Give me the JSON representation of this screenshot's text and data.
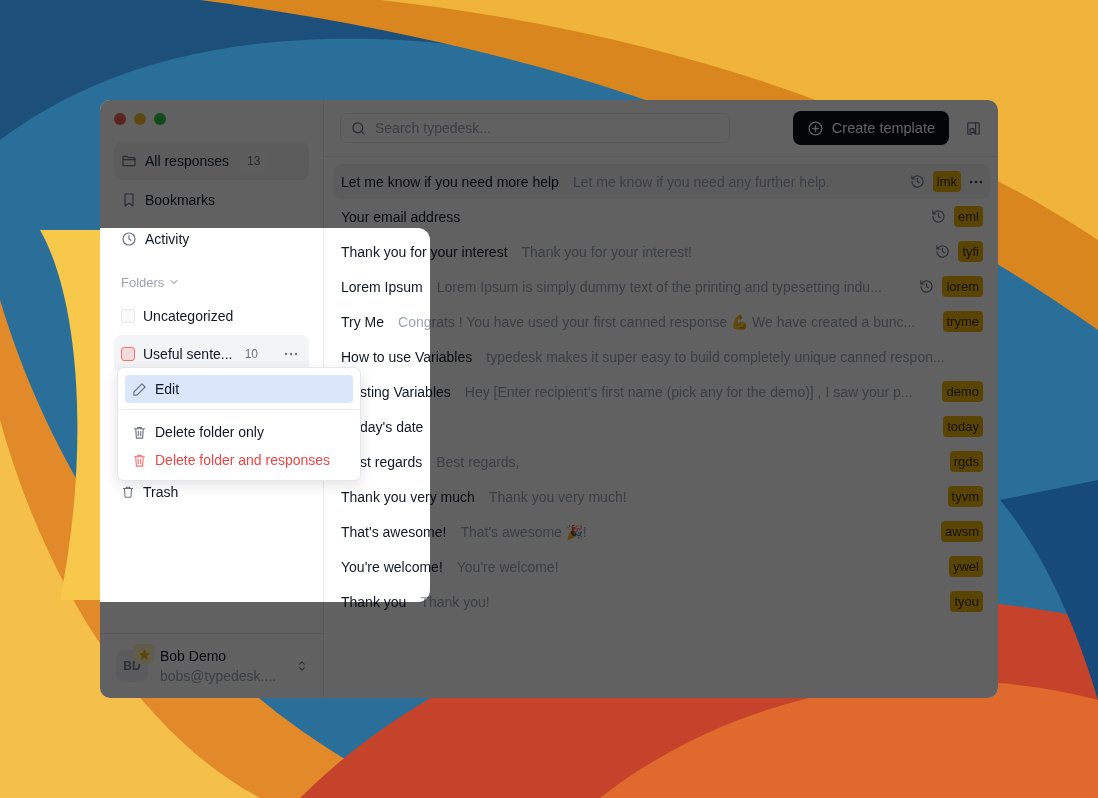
{
  "search": {
    "placeholder": "Search typedesk..."
  },
  "create_button": {
    "label": "Create template"
  },
  "nav": [
    {
      "label": "All responses",
      "count": "13",
      "selected": true
    },
    {
      "label": "Bookmarks",
      "selected": false
    },
    {
      "label": "Activity",
      "selected": false
    }
  ],
  "folders_header": "Folders",
  "folders": [
    {
      "label": "Uncategorized",
      "color": "#e5e7eb",
      "menu_open": false
    },
    {
      "label": "Useful sente...",
      "count": "10",
      "color": "#f87171",
      "menu_open": true
    },
    {
      "label": "Trash",
      "kind": "trash",
      "menu_open": false
    }
  ],
  "context_menu": [
    {
      "label": "Edit",
      "kind": "edit",
      "selected": true
    },
    {
      "label": "Delete folder only",
      "kind": "delete",
      "selected": false
    },
    {
      "label": "Delete folder and responses",
      "kind": "danger",
      "selected": false
    }
  ],
  "user": {
    "initials": "BD",
    "name": "Bob Demo",
    "email": "bobs@typedesk....",
    "starred": true
  },
  "responses": [
    {
      "title": "Let me know if you need more help",
      "preview": "Let me know if you need any further help.",
      "history": true,
      "shortcut": "lmk",
      "selected": true
    },
    {
      "title": "Your email address",
      "history": true,
      "shortcut": "eml",
      "selected": false
    },
    {
      "title": "Thank you for your interest",
      "preview": "Thank you for your interest!",
      "history": true,
      "shortcut": "tyfi",
      "selected": false
    },
    {
      "title": "Lorem Ipsum",
      "preview": "Lorem Ipsum is simply dummy text of the printing and typesetting indu...",
      "history": true,
      "shortcut": "lorem",
      "selected": false
    },
    {
      "title": "Try Me",
      "preview": "Congrats ! You have used your first canned response 💪 We have created a bunc...",
      "shortcut": "tryme",
      "selected": false
    },
    {
      "title": "How to use Variables",
      "preview": "typedesk makes it super easy to build completely unique canned respon...",
      "selected": false
    },
    {
      "title": "sting Variables",
      "preview": "Hey [Enter recipient's first name (pick any for the demo)] , I saw your p...",
      "shortcut": "demo",
      "selected": false,
      "covered": true
    },
    {
      "title": "day's date",
      "shortcut": "today",
      "selected": false,
      "covered": true
    },
    {
      "title": "st regards",
      "preview": "Best regards,",
      "shortcut": "rgds",
      "selected": false,
      "covered": true
    },
    {
      "title": "Thank you very much",
      "preview": "Thank you very much!",
      "shortcut": "tyvm",
      "selected": false
    },
    {
      "title": "That's awesome!",
      "preview": "That's awesome 🎉!",
      "shortcut": "awsm",
      "selected": false
    },
    {
      "title": "You're welcome!",
      "preview": "You're welcome!",
      "shortcut": "ywel",
      "selected": false
    },
    {
      "title": "Thank you",
      "preview": "Thank you!",
      "shortcut": "tyou",
      "selected": false
    }
  ]
}
